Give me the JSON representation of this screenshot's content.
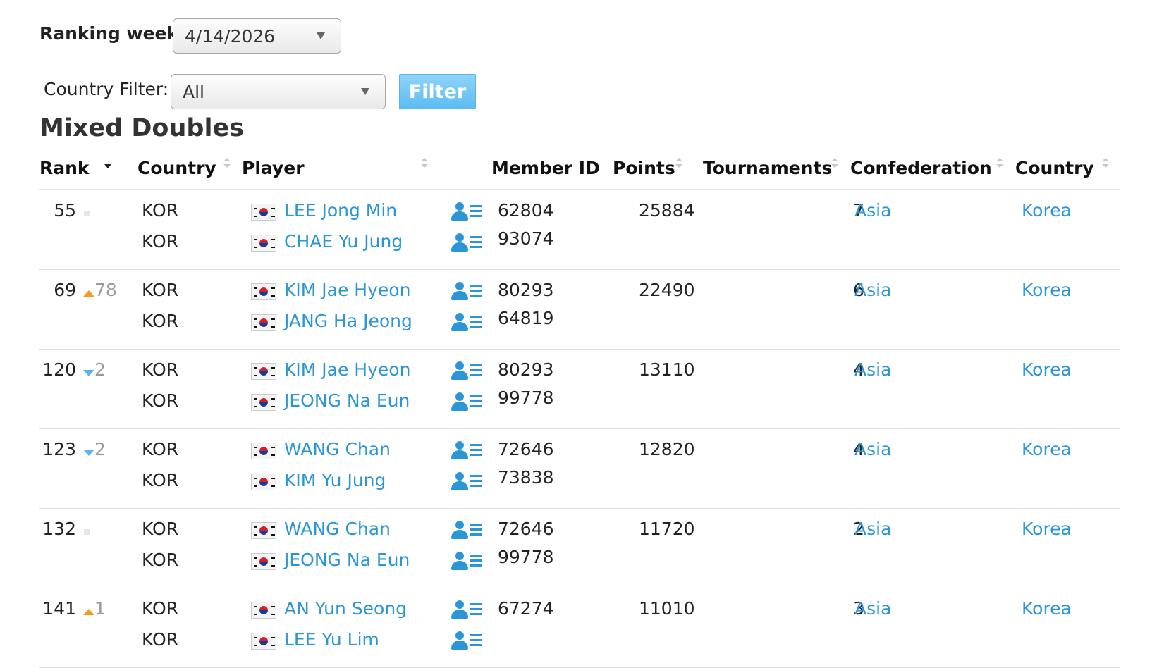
{
  "filters": {
    "ranking_week_label": "Ranking week:",
    "ranking_week_value": "4/14/2026",
    "country_filter_label": "Country Filter:",
    "country_filter_value": "All",
    "filter_button": "Filter"
  },
  "table": {
    "title": "Mixed Doubles",
    "headers": {
      "rank": "Rank",
      "country": "Country",
      "player": "Player",
      "member_id": "Member ID",
      "points": "Points",
      "tournaments": "Tournaments",
      "confederation": "Confederation",
      "country2": "Country"
    },
    "rows": [
      {
        "rank": "55",
        "change_dir": "none",
        "change": "",
        "p1_country": "KOR",
        "p1_name": "LEE Jong Min",
        "p1_id": "62804",
        "p2_country": "KOR",
        "p2_name": "CHAE Yu Jung",
        "p2_id": "93074",
        "points": "25884",
        "tournaments": "7",
        "confederation": "Asia",
        "country_name": "Korea"
      },
      {
        "rank": "69",
        "change_dir": "up",
        "change": "78",
        "p1_country": "KOR",
        "p1_name": "KIM Jae Hyeon",
        "p1_id": "80293",
        "p2_country": "KOR",
        "p2_name": "JANG Ha Jeong",
        "p2_id": "64819",
        "points": "22490",
        "tournaments": "6",
        "confederation": "Asia",
        "country_name": "Korea"
      },
      {
        "rank": "120",
        "change_dir": "down",
        "change": "2",
        "p1_country": "KOR",
        "p1_name": "KIM Jae Hyeon",
        "p1_id": "80293",
        "p2_country": "KOR",
        "p2_name": "JEONG Na Eun",
        "p2_id": "99778",
        "points": "13110",
        "tournaments": "4",
        "confederation": "Asia",
        "country_name": "Korea"
      },
      {
        "rank": "123",
        "change_dir": "down",
        "change": "2",
        "p1_country": "KOR",
        "p1_name": "WANG Chan",
        "p1_id": "72646",
        "p2_country": "KOR",
        "p2_name": "KIM Yu Jung",
        "p2_id": "73838",
        "points": "12820",
        "tournaments": "4",
        "confederation": "Asia",
        "country_name": "Korea"
      },
      {
        "rank": "132",
        "change_dir": "none",
        "change": "",
        "p1_country": "KOR",
        "p1_name": "WANG Chan",
        "p1_id": "72646",
        "p2_country": "KOR",
        "p2_name": "JEONG Na Eun",
        "p2_id": "99778",
        "points": "11720",
        "tournaments": "2",
        "confederation": "Asia",
        "country_name": "Korea"
      },
      {
        "rank": "141",
        "change_dir": "up",
        "change": "1",
        "p1_country": "KOR",
        "p1_name": "AN Yun Seong",
        "p1_id": "67274",
        "p2_country": "KOR",
        "p2_name": "LEE Yu Lim",
        "p2_id": "",
        "points": "11010",
        "tournaments": "3",
        "confederation": "Asia",
        "country_name": "Korea"
      }
    ]
  },
  "icons": {
    "flag": "south-korea-flag-icon",
    "profile": "player-profile-icon",
    "sort": "sort-arrows-icon",
    "rank_up": "rank-up-triangle-icon",
    "rank_down": "rank-down-triangle-icon",
    "rank_same": "rank-unchanged-icon"
  },
  "colors": {
    "link": "#2a96d8",
    "filter_button": "#5dbcf3",
    "rank_up": "#f39b1a",
    "rank_down": "#5ab4ea"
  }
}
